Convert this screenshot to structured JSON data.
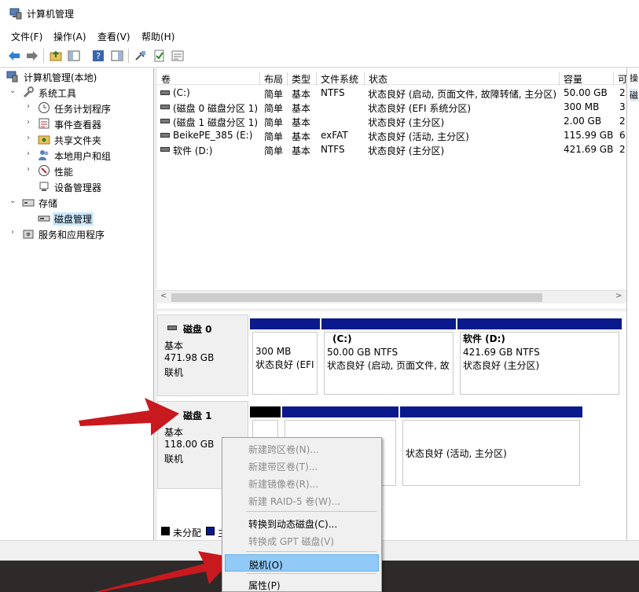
{
  "window": {
    "title": "计算机管理"
  },
  "menu": {
    "file": "文件(F)",
    "action": "操作(A)",
    "view": "查看(V)",
    "help": "帮助(H)"
  },
  "tree": {
    "root": "计算机管理(本地)",
    "system_tools": "系统工具",
    "task_scheduler": "任务计划程序",
    "event_viewer": "事件查看器",
    "shared_folders": "共享文件夹",
    "local_users": "本地用户和组",
    "performance": "性能",
    "device_manager": "设备管理器",
    "storage": "存储",
    "disk_management": "磁盘管理",
    "services_apps": "服务和应用程序"
  },
  "volume_table": {
    "headers": {
      "volume": "卷",
      "layout": "布局",
      "type": "类型",
      "fs": "文件系统",
      "status": "状态",
      "capacity": "容量",
      "extra": "可"
    },
    "rows": [
      {
        "volume": "(C:)",
        "layout": "简单",
        "type": "基本",
        "fs": "NTFS",
        "status": "状态良好 (启动, 页面文件, 故障转储, 主分区)",
        "capacity": "50.00 GB",
        "extra": "2"
      },
      {
        "volume": "(磁盘 0 磁盘分区 1)",
        "layout": "简单",
        "type": "基本",
        "fs": "",
        "status": "状态良好 (EFI 系统分区)",
        "capacity": "300 MB",
        "extra": "3"
      },
      {
        "volume": "(磁盘 1 磁盘分区 1)",
        "layout": "简单",
        "type": "基本",
        "fs": "",
        "status": "状态良好 (主分区)",
        "capacity": "2.00 GB",
        "extra": "2"
      },
      {
        "volume": "BeikePE_385 (E:)",
        "layout": "简单",
        "type": "基本",
        "fs": "exFAT",
        "status": "状态良好 (活动, 主分区)",
        "capacity": "115.99 GB",
        "extra": "6"
      },
      {
        "volume": "软件 (D:)",
        "layout": "简单",
        "type": "基本",
        "fs": "NTFS",
        "status": "状态良好 (主分区)",
        "capacity": "421.69 GB",
        "extra": "2"
      }
    ]
  },
  "actions_panel": {
    "header": "操",
    "item": "磁"
  },
  "disk0": {
    "name": "磁盘 0",
    "type": "基本",
    "size": "471.98 GB",
    "state": "联机",
    "p1": {
      "size": "300 MB",
      "status": "状态良好 (EFI"
    },
    "p2": {
      "title": "(C:)",
      "size": "50.00 GB NTFS",
      "status": "状态良好 (启动, 页面文件, 故"
    },
    "p3": {
      "title": "软件  (D:)",
      "size": "421.69 GB NTFS",
      "status": "状态良好 (主分区)"
    }
  },
  "disk1": {
    "name": "磁盘 1",
    "type": "基本",
    "size": "118.00 GB",
    "state": "联机",
    "p3": {
      "status": "状态良好 (活动, 主分区)"
    }
  },
  "legend": {
    "unallocated": "未分配",
    "primary": "主"
  },
  "context_menu": {
    "new_spanned": "新建跨区卷(N)...",
    "new_striped": "新建带区卷(T)...",
    "new_mirrored": "新建镜像卷(R)...",
    "new_raid5": "新建 RAID-5 卷(W)...",
    "to_dynamic": "转换到动态磁盘(C)...",
    "to_gpt": "转换成 GPT 磁盘(V)",
    "offline": "脱机(O)",
    "properties": "属性(P)"
  },
  "colors": {
    "primary_partition": "#0a1a8c",
    "unallocated": "#000000",
    "menu_highlight": "#91c9f7",
    "arrow": "#c8191e"
  }
}
